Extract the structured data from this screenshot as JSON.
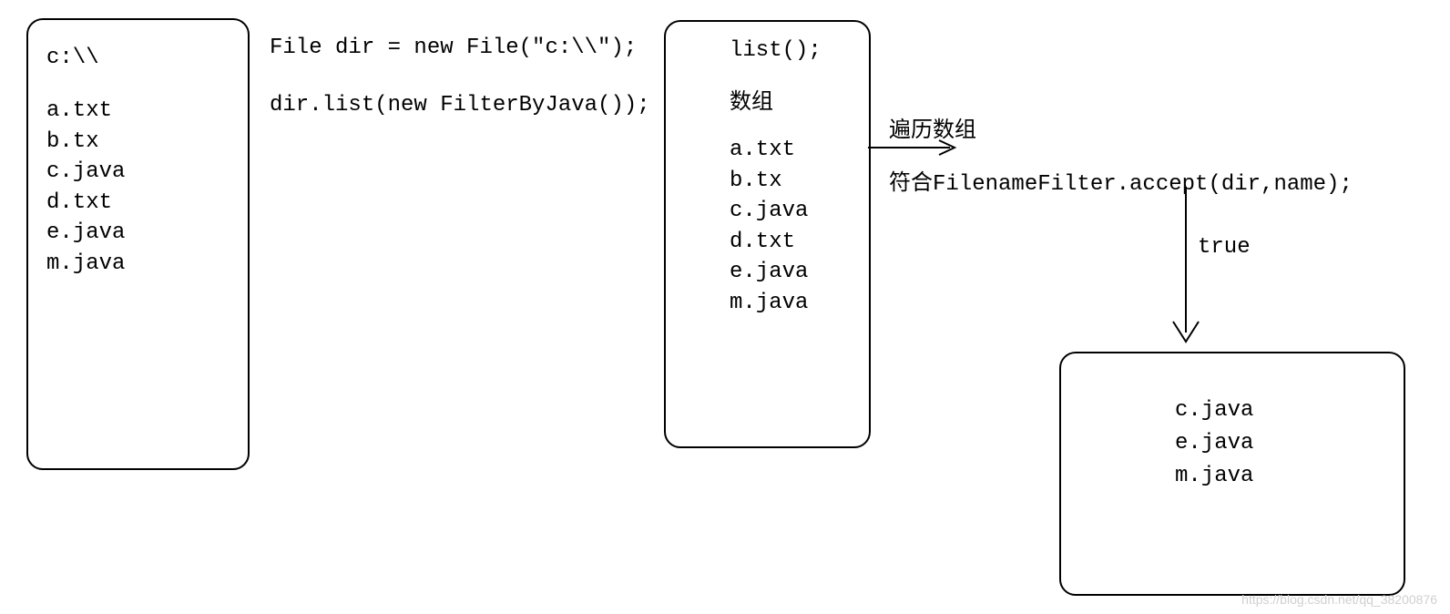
{
  "box1": {
    "title": "c:\\\\",
    "files": [
      "a.txt",
      "b.tx",
      "c.java",
      "d.txt",
      "e.java",
      "m.java"
    ]
  },
  "code": {
    "line1": "File dir = new File(\"c:\\\\\");",
    "line2": "dir.list(new FilterByJava());"
  },
  "box2": {
    "title": "list();",
    "subtitle": "数组",
    "files": [
      "a.txt",
      "b.tx",
      "c.java",
      "d.txt",
      "e.java",
      "m.java"
    ]
  },
  "labels": {
    "traverse": "遍历数组",
    "filter": "符合FilenameFilter.accept(dir,name);",
    "true": "true"
  },
  "box3": {
    "files": [
      "c.java",
      "e.java",
      "m.java"
    ]
  },
  "watermark": "https://blog.csdn.net/qq_38200876"
}
